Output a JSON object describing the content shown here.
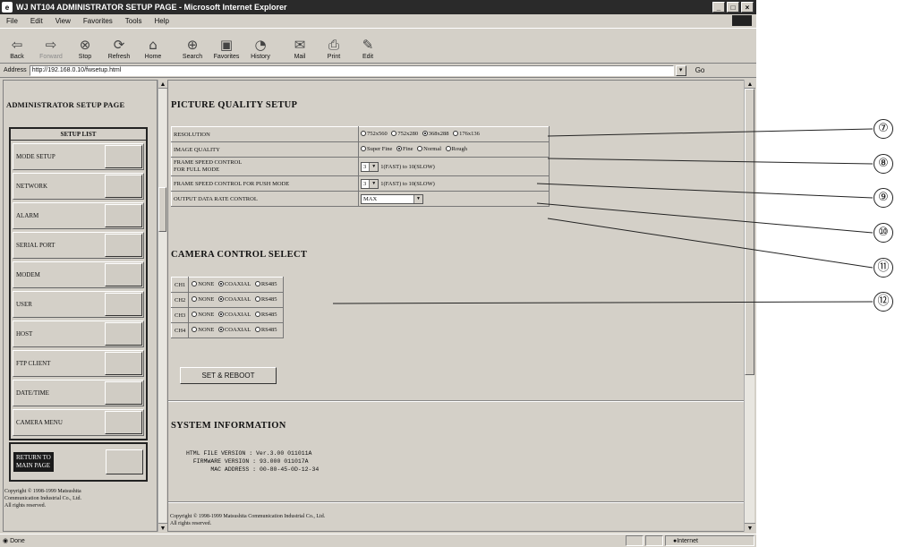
{
  "window": {
    "title": "WJ NT104 ADMINISTRATOR SETUP PAGE - Microsoft Internet Explorer"
  },
  "menu": [
    "File",
    "Edit",
    "View",
    "Favorites",
    "Tools",
    "Help"
  ],
  "toolbar": {
    "buttons": [
      {
        "label": "Back",
        "icon": "back-arrow-icon"
      },
      {
        "label": "Forward",
        "icon": "forward-arrow-icon"
      },
      {
        "label": "Stop",
        "icon": "stop-icon"
      },
      {
        "label": "Refresh",
        "icon": "refresh-icon"
      },
      {
        "label": "Home",
        "icon": "home-icon"
      },
      {
        "label": "Search",
        "icon": "search-icon"
      },
      {
        "label": "Favorites",
        "icon": "favorites-icon"
      },
      {
        "label": "History",
        "icon": "history-icon"
      },
      {
        "label": "Mail",
        "icon": "mail-icon"
      },
      {
        "label": "Print",
        "icon": "print-icon"
      },
      {
        "label": "Edit",
        "icon": "edit-icon"
      }
    ]
  },
  "address": {
    "label": "Address",
    "url": "http://192.168.0.10/fwsetup.html",
    "go": "Go"
  },
  "left": {
    "title": "ADMINISTRATOR SETUP PAGE",
    "setup_list_header": "SETUP LIST",
    "items": [
      "MODE SETUP",
      "NETWORK",
      "ALARM",
      "SERIAL PORT",
      "MODEM",
      "USER",
      "HOST",
      "FTP CLIENT",
      "DATE/TIME",
      "CAMERA MENU"
    ],
    "return_label_1": "RETURN TO",
    "return_label_2": "MAIN PAGE",
    "copyright_1": "Copyright © 1998-1999 Matsushita",
    "copyright_2": "Communication Industrial Co., Ltd.",
    "copyright_3": "All rights reserved."
  },
  "picture_quality": {
    "title": "PICTURE QUALITY SETUP",
    "resolution_label": "RESOLUTION",
    "resolution_options": [
      "752x560",
      "752x280",
      "368x288",
      "176x136"
    ],
    "resolution_selected": 2,
    "image_quality_label": "IMAGE QUALITY",
    "image_quality_options": [
      "Super Fine",
      "Fine",
      "Normal",
      "Rough"
    ],
    "image_quality_selected": 1,
    "frame_speed_full_label_1": "FRAME SPEED CONTROL",
    "frame_speed_full_label_2": "FOR FULL MODE",
    "frame_speed_full_value": "3",
    "frame_speed_hint": "1(FAST) to 10(SLOW)",
    "frame_speed_push_label": "FRAME SPEED CONTROL FOR PUSH MODE",
    "frame_speed_push_value": "3",
    "output_rate_label": "OUTPUT DATA RATE CONTROL",
    "output_rate_value": "MAX"
  },
  "camera_control": {
    "title": "CAMERA CONTROL SELECT",
    "channels": [
      "CH1",
      "CH2",
      "CH3",
      "CH4"
    ],
    "options": [
      "NONE",
      "COAXIAL",
      "RS485"
    ],
    "selected": 1
  },
  "reboot_button": "SET & REBOOT",
  "system_info": {
    "title": "SYSTEM INFORMATION",
    "html_version_label": "HTML FILE VERSION",
    "html_version": "Ver.3.00 011011A",
    "firmware_label": "FIRMWARE VERSION",
    "firmware": "93.000 011017A",
    "mac_label": "MAC ADDRESS",
    "mac": "00-80-45-0D-12-34"
  },
  "right_copyright_1": "Copyright © 1998-1999 Matsushita Communication Industrial Co., Ltd.",
  "right_copyright_2": "All rights reserved.",
  "status": {
    "text": "Done",
    "zone": "Internet"
  },
  "callouts": [
    "⑦",
    "⑧",
    "⑨",
    "⑩",
    "⑪",
    "⑫"
  ]
}
